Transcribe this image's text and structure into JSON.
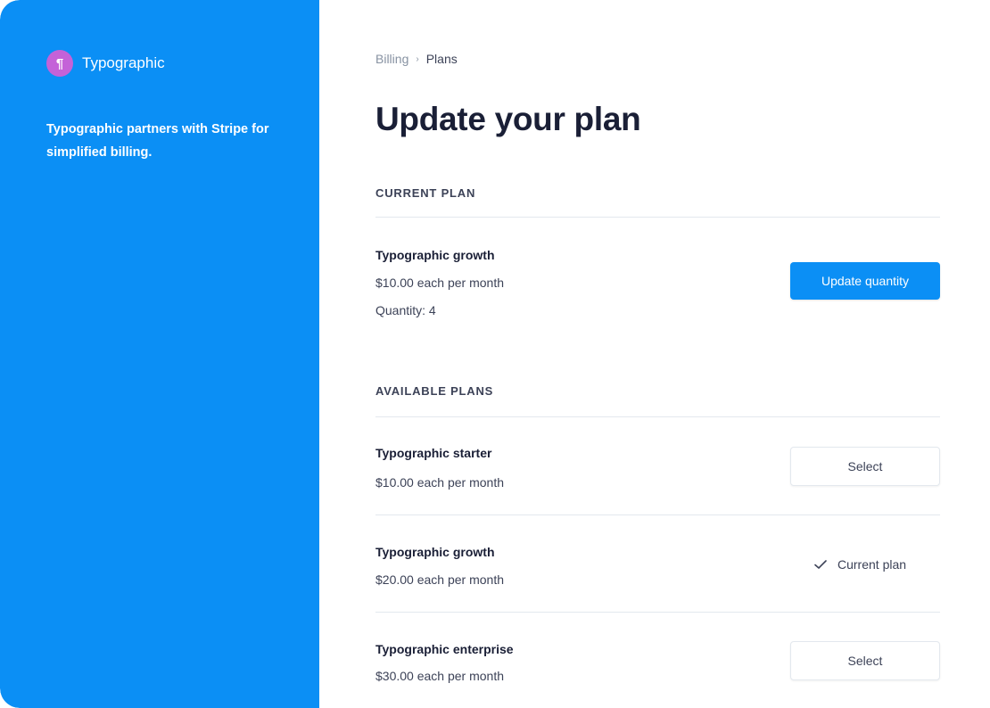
{
  "sidebar": {
    "brand_logo_glyph": "¶",
    "brand_name": "Typographic",
    "tagline": "Typographic partners with Stripe for simplified billing.",
    "background_color": "#0b8ff5",
    "logo_color": "#c462d8"
  },
  "breadcrumb": {
    "items": [
      "Billing",
      "Plans"
    ],
    "separator": "›"
  },
  "page_title": "Update your plan",
  "current_plan": {
    "section_label": "CURRENT PLAN",
    "name": "Typographic growth",
    "price": "$10.00 each per month",
    "quantity": "Quantity: 4",
    "button_label": "Update quantity"
  },
  "available_plans": {
    "section_label": "AVAILABLE PLANS",
    "plans": [
      {
        "name": "Typographic starter",
        "price": "$10.00 each per month",
        "action": "Select"
      },
      {
        "name": "Typographic growth",
        "price": "$20.00 each per month",
        "action": "Current plan",
        "is_current": true,
        "icon": "check-icon"
      },
      {
        "name": "Typographic enterprise",
        "price": "$30.00 each per month",
        "action": "Select"
      }
    ]
  },
  "colors": {
    "accent": "#0b8ff5",
    "text_primary": "#1a1f36",
    "text_secondary": "#3c4257",
    "muted": "#8792a2",
    "divider": "#e3e8ee"
  }
}
